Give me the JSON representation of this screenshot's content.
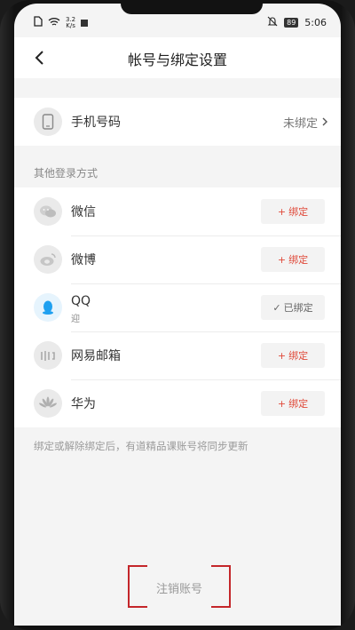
{
  "status_bar": {
    "speed_value": "3.2",
    "speed_unit": "K/s",
    "battery": "89",
    "time": "5:06"
  },
  "header": {
    "title": "帐号与绑定设置"
  },
  "phone": {
    "label": "手机号码",
    "status": "未绑定"
  },
  "section_title": "其他登录方式",
  "providers": [
    {
      "name": "微信",
      "icon": "wechat-icon",
      "button": "绑定",
      "bound": false
    },
    {
      "name": "微博",
      "icon": "weibo-icon",
      "button": "绑定",
      "bound": false
    },
    {
      "name": "QQ",
      "sub": "迎",
      "icon": "qq-icon",
      "button": "已绑定",
      "bound": true
    },
    {
      "name": "网易邮箱",
      "icon": "netease-mail-icon",
      "button": "绑定",
      "bound": false
    },
    {
      "name": "华为",
      "icon": "huawei-icon",
      "button": "绑定",
      "bound": false
    }
  ],
  "footnote": "绑定或解除绑定后，有道精品课账号将同步更新",
  "cancel_account": "注销账号",
  "colors": {
    "accent": "#e04a3a",
    "highlight_box": "#c4262a",
    "qq_blue": "#1ea0f0"
  }
}
